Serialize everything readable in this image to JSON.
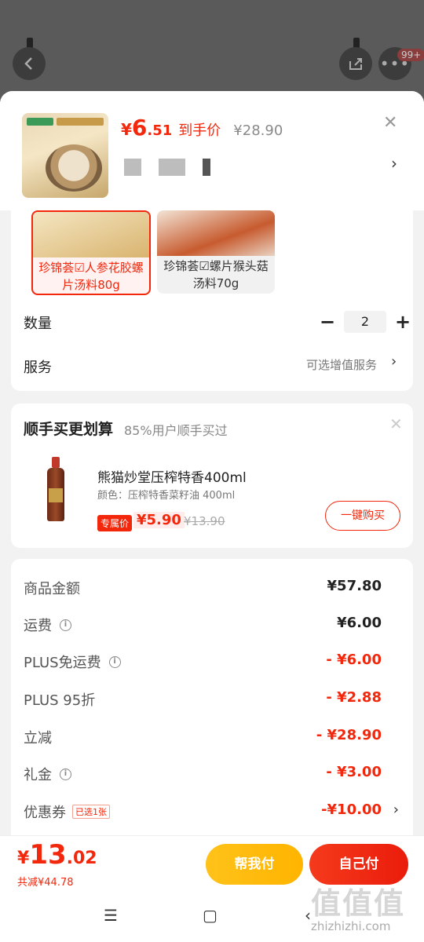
{
  "background": {
    "notification_badge": "99+"
  },
  "product": {
    "price_yen": "¥",
    "price_int": "6",
    "price_dec": ".51",
    "price_tag": "到手价",
    "original_price": "¥28.90"
  },
  "variants": [
    {
      "label": "珍锦荟☑人参花胶螺片汤料80g",
      "selected": true
    },
    {
      "label": "珍锦荟☑螺片猴头菇汤料70g",
      "selected": false
    }
  ],
  "quantity": {
    "label": "数量",
    "value": "2",
    "minus": "−",
    "plus": "+"
  },
  "service": {
    "label": "服务",
    "hint": "可选增值服务"
  },
  "addon": {
    "title": "顺手买更划算",
    "subtitle": "85%用户顺手买过",
    "item_name": "熊猫炒堂压榨特香400ml",
    "item_spec": "颜色：压榨特香菜籽油 400ml",
    "tag": "专属价",
    "price": "¥5.90",
    "original_price": "¥13.90",
    "buy_button": "一键购买"
  },
  "summary": [
    {
      "label": "商品金额",
      "value": "¥57.80",
      "info": false,
      "red": false
    },
    {
      "label": "运费",
      "value": "¥6.00",
      "info": true,
      "red": false
    },
    {
      "label": "PLUS免运费",
      "value": "- ¥6.00",
      "info": true,
      "red": true
    },
    {
      "label": "PLUS 95折",
      "value": "- ¥2.88",
      "info": false,
      "red": true
    },
    {
      "label": "立减",
      "value": "- ¥28.90",
      "info": false,
      "red": true
    },
    {
      "label": "礼金",
      "value": "- ¥3.00",
      "info": true,
      "red": true
    },
    {
      "label": "优惠券",
      "value": "-¥10.00",
      "info": false,
      "red": true,
      "tag": "已选1张"
    }
  ],
  "bottom": {
    "price_yen": "¥",
    "price_int": "13",
    "price_dec": ".02",
    "saved": "共减¥44.78",
    "help_pay": "帮我付",
    "self_pay": "自己付"
  },
  "watermark": {
    "chars": "值值值",
    "url": "zhizhizhi.com"
  },
  "colors": {
    "accent": "#f2270c",
    "yellow": "#ffb400"
  }
}
